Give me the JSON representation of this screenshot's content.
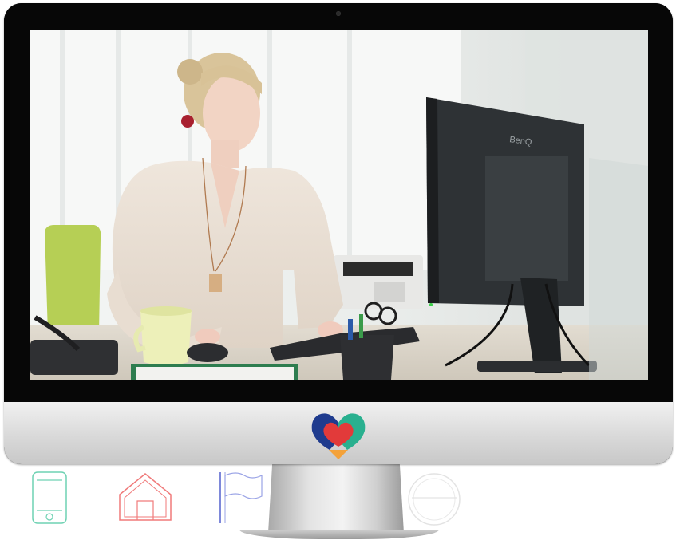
{
  "brand": {
    "colors": {
      "navy": "#1f3b8e",
      "teal": "#29b08f",
      "red": "#e23a3a",
      "orange": "#f4a23a"
    },
    "logo_icon": "heart-logo-icon"
  },
  "video": {
    "monitor_brand_text": "BenQ"
  },
  "background_icons": [
    "phone-outline-icon",
    "house-outline-icon",
    "flag-outline-icon",
    "circle-outline-icon"
  ]
}
